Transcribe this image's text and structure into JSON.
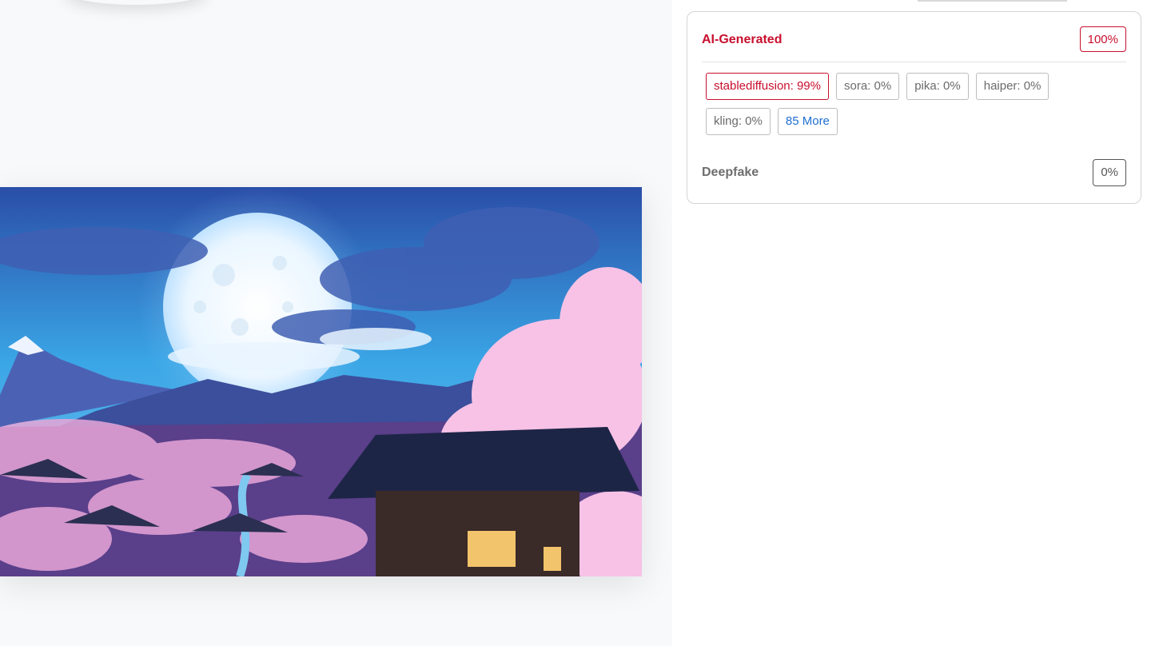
{
  "results": {
    "ai_generated": {
      "label": "AI-Generated",
      "score": "100%"
    },
    "models": [
      {
        "text": "stablediffusion: 99%",
        "highlight": true
      },
      {
        "text": "sora: 0%",
        "highlight": false
      },
      {
        "text": "pika: 0%",
        "highlight": false
      },
      {
        "text": "haiper: 0%",
        "highlight": false
      },
      {
        "text": "kling: 0%",
        "highlight": false
      }
    ],
    "more_label": "85 More",
    "deepfake": {
      "label": "Deepfake",
      "score": "0%"
    }
  },
  "colors": {
    "accent_red": "#c8102e",
    "link_blue": "#1f6fd1",
    "muted_gray": "#6b6b6b"
  }
}
